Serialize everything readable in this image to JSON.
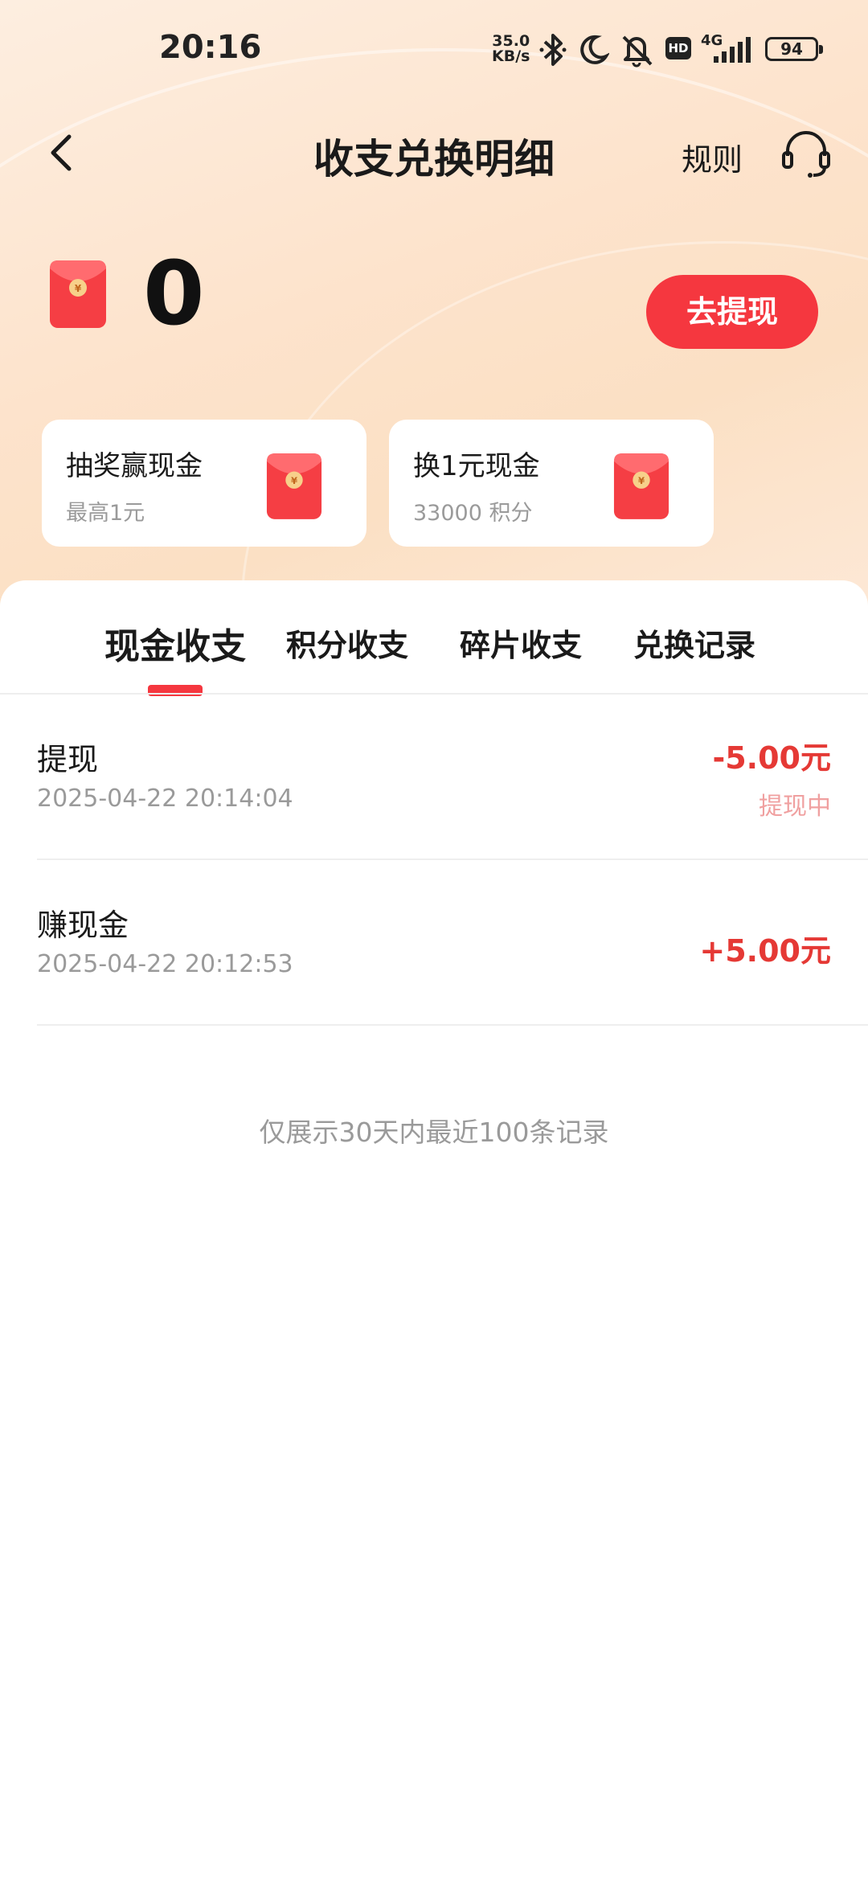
{
  "status_bar": {
    "time": "20:16",
    "net_speed_value": "35.0",
    "net_speed_unit": "KB/s",
    "network": "4G",
    "hd": "HD",
    "battery": "94"
  },
  "header": {
    "title": "收支兑换明细",
    "rules_label": "规则"
  },
  "balance": {
    "value": "0",
    "withdraw_label": "去提现"
  },
  "cards": [
    {
      "title": "抽奖赢现金",
      "subtitle": "最高1元"
    },
    {
      "title": "换1元现金",
      "subtitle": "33000 积分"
    }
  ],
  "tabs": [
    {
      "label": "现金收支",
      "active": true
    },
    {
      "label": "积分收支",
      "active": false
    },
    {
      "label": "碎片收支",
      "active": false
    },
    {
      "label": "兑换记录",
      "active": false
    }
  ],
  "records": [
    {
      "title": "提现",
      "time": "2025-04-22 20:14:04",
      "amount": "-5.00元",
      "status": "提现中"
    },
    {
      "title": "赚现金",
      "time": "2025-04-22 20:12:53",
      "amount": "+5.00元",
      "status": ""
    }
  ],
  "footer_note": "仅展示30天内最近100条记录",
  "colors": {
    "accent": "#f5373f",
    "amount": "#e53935",
    "status_pending": "#f0a0a0"
  }
}
